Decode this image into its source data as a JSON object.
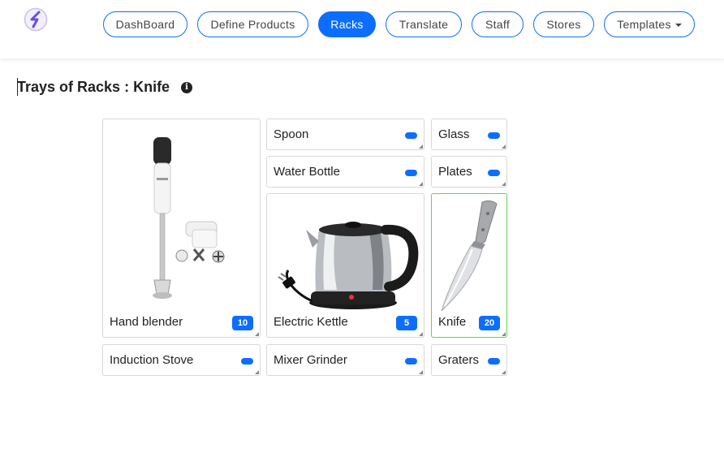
{
  "nav": {
    "items": [
      {
        "label": "DashBoard"
      },
      {
        "label": "Define Products"
      },
      {
        "label": "Racks"
      },
      {
        "label": "Translate"
      },
      {
        "label": "Staff"
      },
      {
        "label": "Stores"
      },
      {
        "label": "Templates"
      }
    ],
    "active": "Racks",
    "accent_color": "#0d6efd"
  },
  "page": {
    "title": "Trays of Racks : Knife",
    "info_icon": "info-circle-icon"
  },
  "trays": {
    "hand_blender": {
      "label": "Hand blender",
      "count": "10"
    },
    "spoon": {
      "label": "Spoon"
    },
    "glass": {
      "label": "Glass"
    },
    "water_bottle": {
      "label": "Water Bottle"
    },
    "plates": {
      "label": "Plates"
    },
    "electric_kettle": {
      "label": "Electric Kettle",
      "count": "5"
    },
    "knife": {
      "label": "Knife",
      "count": "20",
      "selected": true
    },
    "induction_stove": {
      "label": "Induction Stove"
    },
    "mixer_grinder": {
      "label": "Mixer Grinder"
    },
    "graters": {
      "label": "Graters"
    }
  },
  "colors": {
    "selected_border": "#5cd65c",
    "badge": "#0d6efd"
  }
}
